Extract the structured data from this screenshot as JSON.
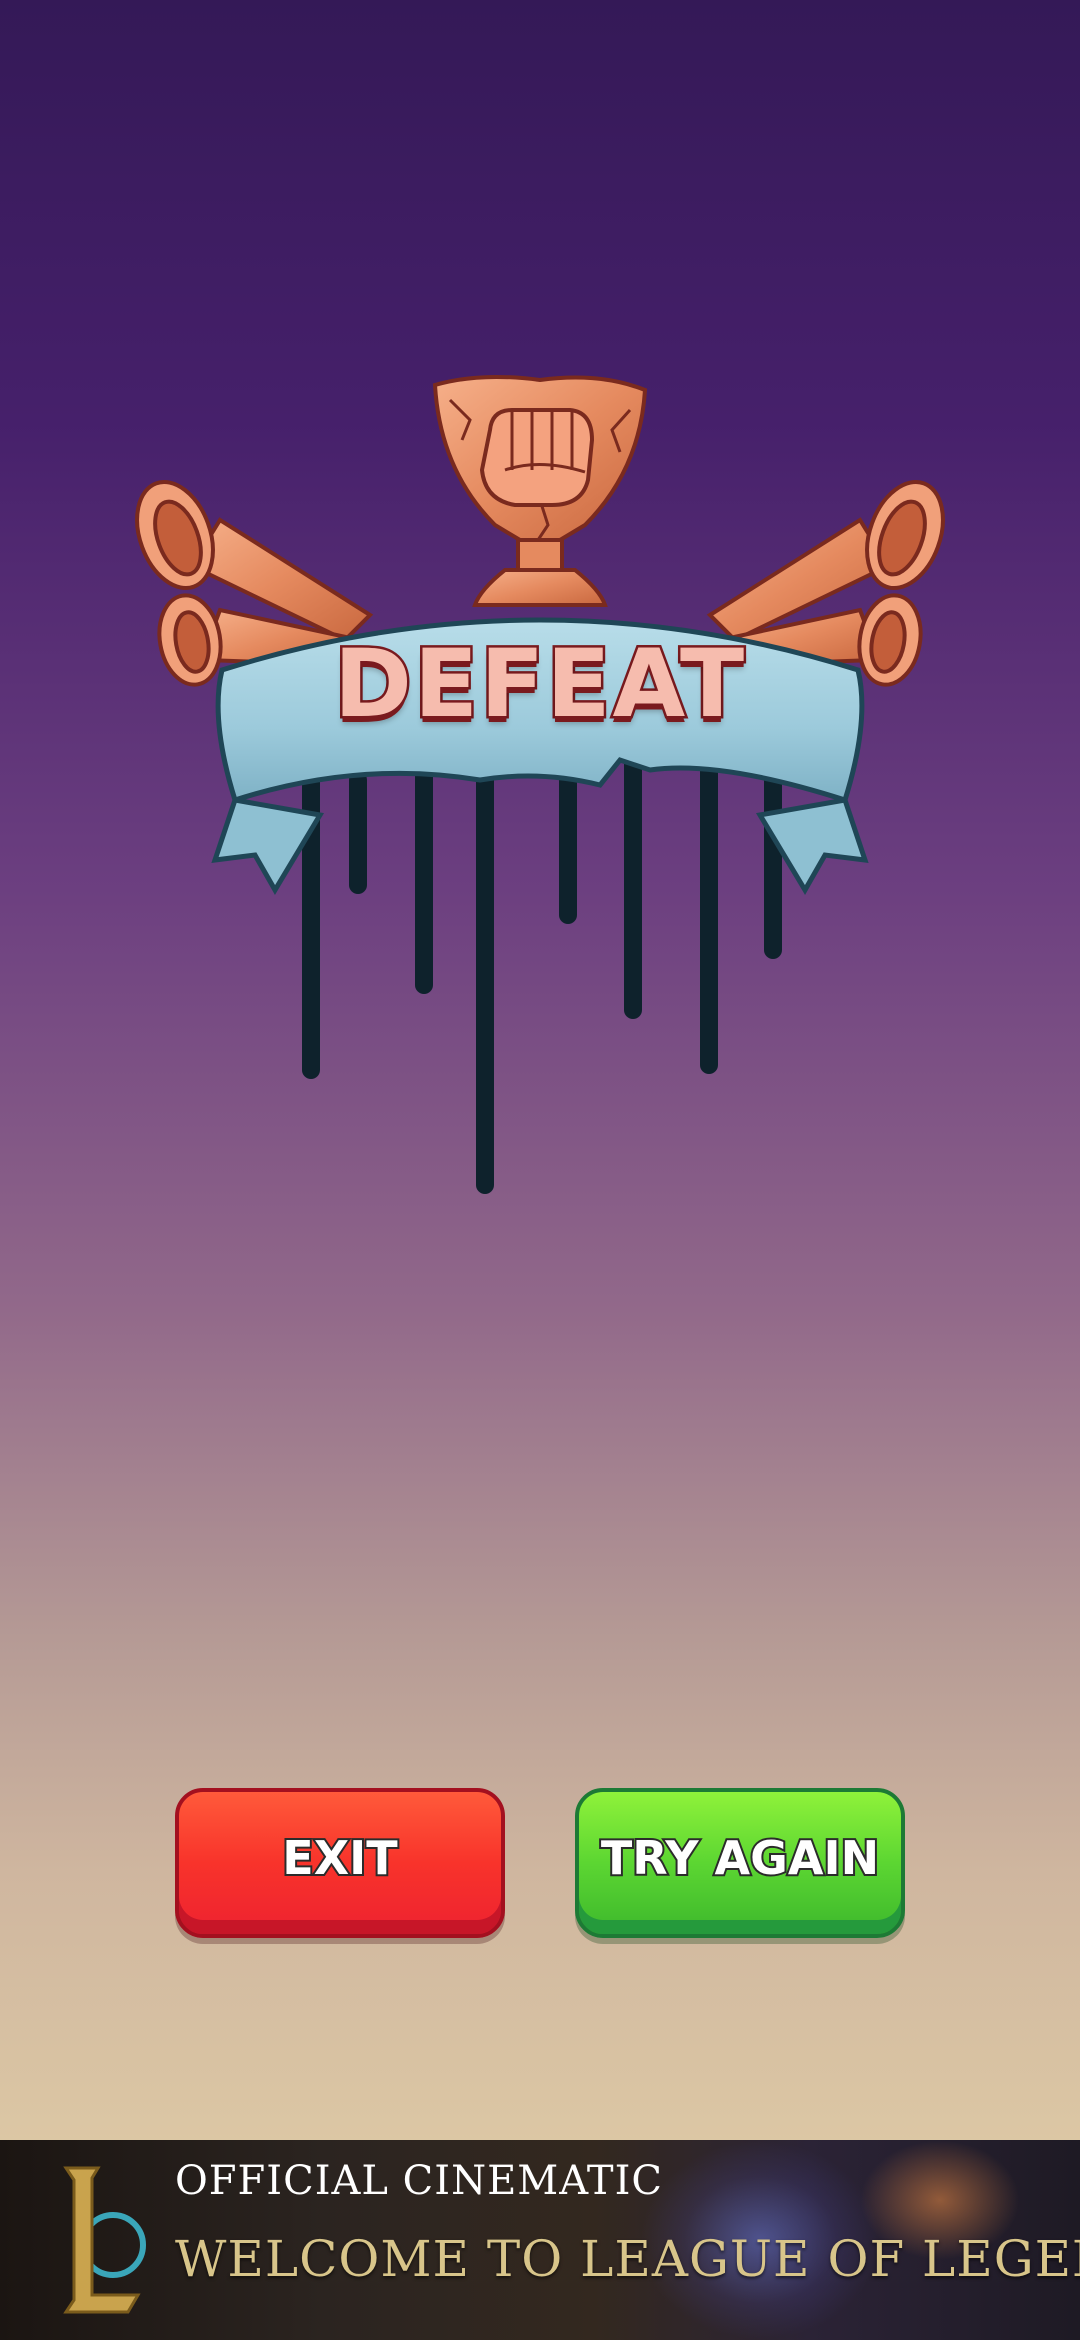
{
  "result": {
    "title": "DEFEAT",
    "trophy_icon": "cracked-bronze-trophy-with-fist",
    "banner_color": "#9fcbdc",
    "drip_color": "#0e222c"
  },
  "buttons": {
    "exit_label": "EXIT",
    "exit_color": "#f8332b",
    "retry_label": "TRY AGAIN",
    "retry_color": "#5cd632"
  },
  "ad": {
    "line1": "OFFICIAL CINEMATIC",
    "line2": "WELCOME TO LEAGUE OF LEGENDS",
    "logo_icon": "league-of-legends-logo"
  }
}
